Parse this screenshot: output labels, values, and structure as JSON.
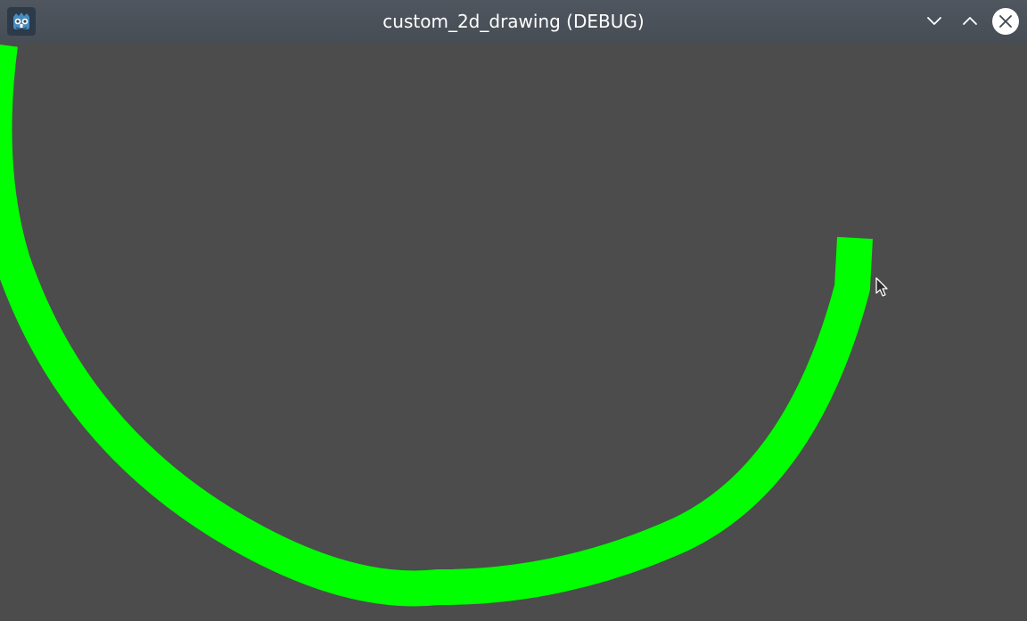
{
  "window": {
    "title": "custom_2d_drawing (DEBUG)",
    "app_icon": "godot-icon"
  },
  "controls": {
    "minimize_icon": "chevron-down-icon",
    "maximize_icon": "chevron-up-icon",
    "close_icon": "close-icon"
  },
  "canvas": {
    "background_color": "#4c4c4c",
    "arc_color": "#00ff00",
    "cursor_icon": "mouse-cursor-icon"
  }
}
